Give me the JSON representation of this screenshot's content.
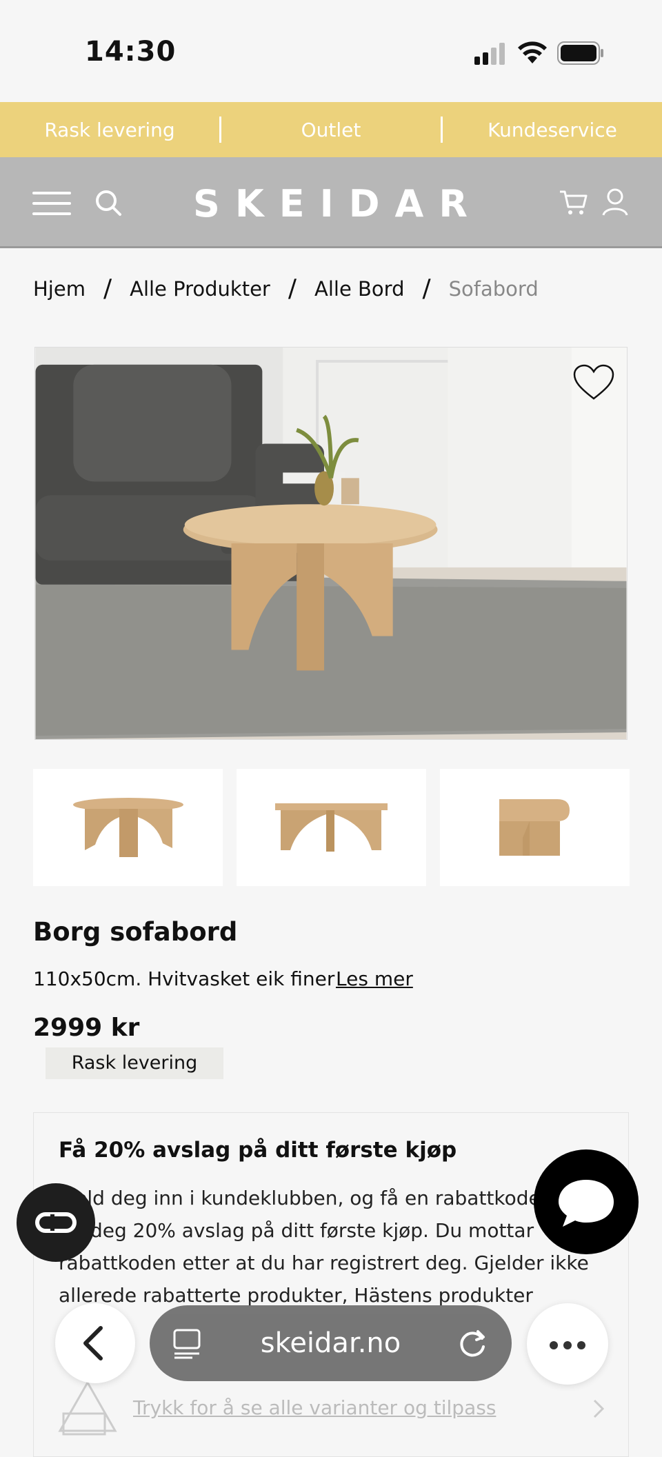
{
  "status_bar": {
    "time": "14:30"
  },
  "promo_bar": {
    "items": [
      "Rask levering",
      "Outlet",
      "Kundeservice"
    ]
  },
  "header": {
    "logo": "SKEIDAR"
  },
  "breadcrumb": [
    "Hjem",
    "Alle Produkter",
    "Alle Bord",
    "Sofabord"
  ],
  "breadcrumb_separator": "/",
  "product": {
    "title": "Borg sofabord",
    "description": "110x50cm. Hvitvasket eik finer",
    "read_more": "Les mer",
    "price": "2999 kr",
    "badge": "Rask levering"
  },
  "promo_card": {
    "title": "Få 20% avslag på ditt første kjøp",
    "body": "Meld deg inn i kundeklubben, og få en rabattkode som gir deg 20% avslag på ditt første kjøp. Du mottar rabattkoden etter at du har registrert deg. Gjelder ikke allerede rabatterte produkter, Hästens produkter"
  },
  "variants_link": "Trykk for å se alle varianter og tilpass",
  "browser": {
    "url": "skeidar.no"
  },
  "colors": {
    "promo_bg": "#ecd27c",
    "header_bg": "#b7b7b7",
    "page_bg": "#f6f6f6"
  }
}
